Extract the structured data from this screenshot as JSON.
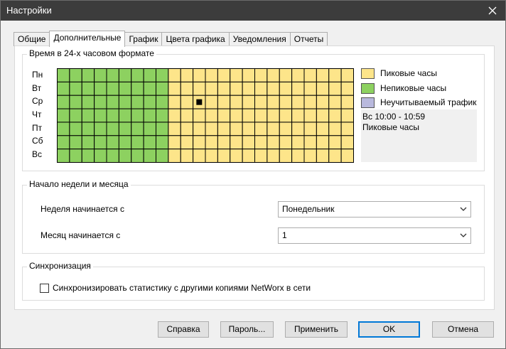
{
  "window": {
    "title": "Настройки"
  },
  "tabs": [
    {
      "label": "Общие"
    },
    {
      "label": "Дополнительные"
    },
    {
      "label": "График"
    },
    {
      "label": "Цвета графика"
    },
    {
      "label": "Уведомления"
    },
    {
      "label": "Отчеты"
    }
  ],
  "active_tab_index": 1,
  "time_section": {
    "title": "Время в 24-х часовом формате",
    "days": [
      "Пн",
      "Вт",
      "Ср",
      "Чт",
      "Пт",
      "Сб",
      "Вс"
    ],
    "hours_per_day": 24,
    "offpeak_hours_until": 9,
    "selected_cell": {
      "day": "Ср",
      "hour": 11
    },
    "colors": {
      "peak": "#fde58a",
      "offpeak": "#8dd160",
      "unaccounted": "#b9b9dd",
      "selected": "#000000"
    },
    "legend": [
      {
        "label": "Пиковые часы",
        "color": "#fde58a"
      },
      {
        "label": "Непиковые часы",
        "color": "#8dd160"
      },
      {
        "label": "Неучитываемый трафик",
        "color": "#b9b9dd"
      }
    ],
    "info_line1": "Вс 10:00 - 10:59",
    "info_line2": "Пиковые часы"
  },
  "week_section": {
    "title": "Начало недели и месяца",
    "week_label": "Неделя начинается с",
    "week_value": "Понедельник",
    "month_label": "Месяц начинается с",
    "month_value": "1"
  },
  "sync_section": {
    "title": "Синхронизация",
    "checkbox_label": "Синхронизировать статистику с другими копиями NetWorx в сети",
    "checked": false
  },
  "buttons": {
    "help": "Справка",
    "password": "Пароль...",
    "apply": "Применить",
    "ok": "OK",
    "cancel": "Отмена"
  }
}
